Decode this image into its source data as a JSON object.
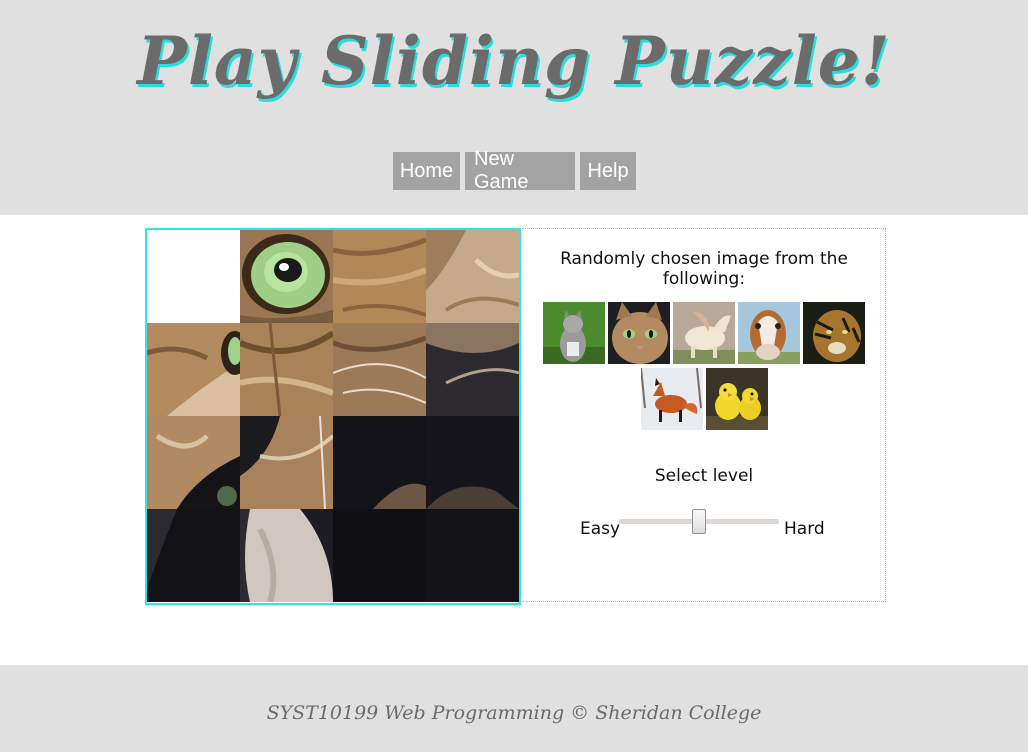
{
  "header": {
    "title": "Play Sliding Puzzle!",
    "nav": [
      {
        "label": "Home"
      },
      {
        "label": "New Game"
      },
      {
        "label": "Help"
      }
    ]
  },
  "panel": {
    "heading": "Randomly chosen image from the following:",
    "thumbnails": [
      {
        "subject": "cat-in-grass"
      },
      {
        "subject": "cat-face"
      },
      {
        "subject": "white-horse"
      },
      {
        "subject": "horse-face"
      },
      {
        "subject": "tiger"
      },
      {
        "subject": "fox"
      },
      {
        "subject": "chicks"
      }
    ],
    "level": {
      "label": "Select level",
      "min_label": "Easy",
      "max_label": "Hard",
      "value_fraction": 0.5
    }
  },
  "puzzle": {
    "grid": "4x4",
    "empty_tile": 0
  },
  "footer": {
    "text": "SYST10199 Web Programming © Sheridan College"
  },
  "colors": {
    "header_bg": "#e0e0e0",
    "title_shadow": "#26dede",
    "nav_button": "#a3a3a3",
    "board_border": "#2be6e6"
  }
}
